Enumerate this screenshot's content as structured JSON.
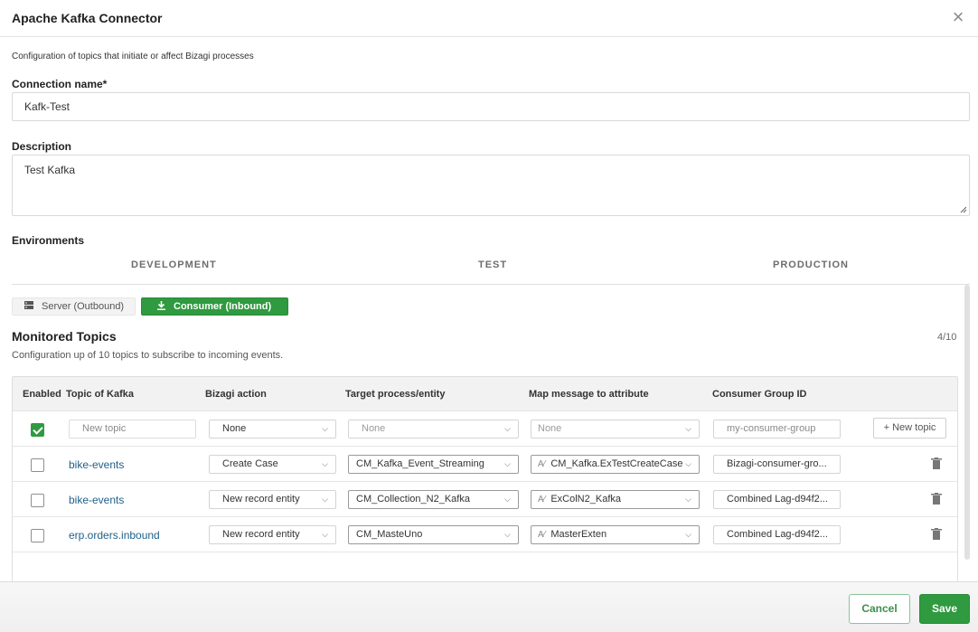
{
  "dialog": {
    "title": "Apache Kafka Connector",
    "intro": "Configuration of topics that initiate or affect Bizagi processes"
  },
  "form": {
    "connection_label": "Connection name*",
    "connection_value": "Kafk-Test",
    "description_label": "Description",
    "description_value": "Test Kafka",
    "environments_label": "Environments"
  },
  "environments": {
    "tabs": [
      "DEVELOPMENT",
      "TEST",
      "PRODUCTION"
    ],
    "active": "DEVELOPMENT"
  },
  "modes": {
    "server_label": "Server (Outbound)",
    "consumer_label": "Consumer (Inbound)",
    "active": "consumer"
  },
  "topics": {
    "title": "Monitored Topics",
    "subtitle": "Configuration up of 10 topics to subscribe to incoming events.",
    "count": "4/10",
    "columns": [
      "Enabled",
      "Topic of Kafka",
      "Bizagi action",
      "Target process/entity",
      "Map message to attribute",
      "Consumer Group ID"
    ],
    "new_row": {
      "enabled": true,
      "topic_placeholder": "New topic",
      "action": "None",
      "target_placeholder": "None",
      "map_placeholder": "None",
      "group_placeholder": "my-consumer-group",
      "add_button": "New topic"
    },
    "rows": [
      {
        "enabled": false,
        "topic": "bike-events",
        "action": "Create Case",
        "target": "CM_Kafka_Event_Streaming",
        "map": "CM_Kafka.ExTestCreateCase",
        "group": "Bizagi-consumer-gro..."
      },
      {
        "enabled": false,
        "topic": "bike-events",
        "action": "New record entity",
        "target": "CM_Collection_N2_Kafka",
        "map": "ExColN2_Kafka",
        "group": "Combined Lag-d94f2..."
      },
      {
        "enabled": false,
        "topic": "erp.orders.inbound",
        "action": "New record entity",
        "target": "CM_MasteUno",
        "map": "MasterExten",
        "group": "Combined Lag-d94f2..."
      }
    ]
  },
  "footer": {
    "cancel_label": "Cancel",
    "save_label": "Save"
  },
  "colors": {
    "accent": "#2f9a3f",
    "link": "#1f5f8a",
    "header_bg": "#f2f2f2"
  },
  "icons": [
    "close-icon",
    "server-icon",
    "download-icon",
    "chevron-down-icon",
    "plus-icon",
    "trash-icon",
    "map-attribute-icon",
    "check-icon"
  ]
}
